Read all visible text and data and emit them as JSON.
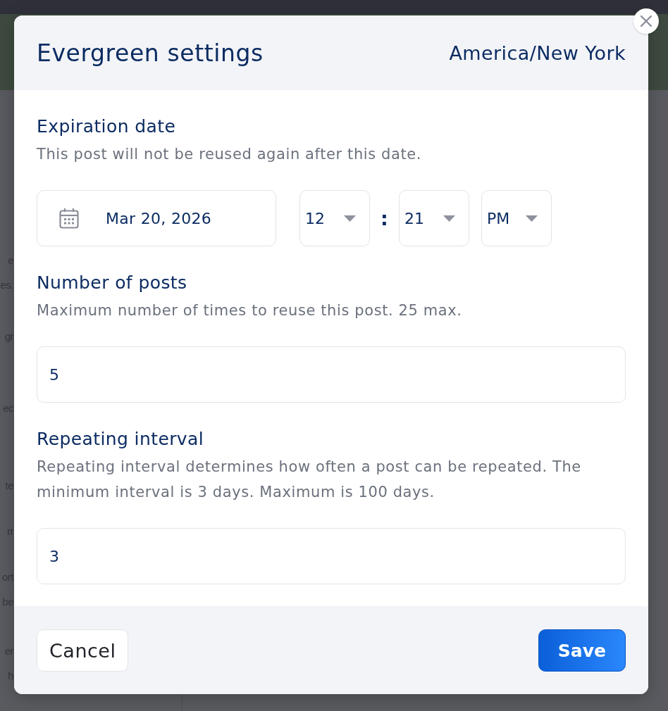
{
  "backdrop": {
    "text_fragments": [
      {
        "lines": [
          "e",
          "es."
        ]
      },
      {
        "lines": [
          "gr"
        ]
      },
      {
        "lines": [
          "ec"
        ]
      },
      {
        "lines": [
          "te"
        ]
      },
      {
        "lines": [
          "rr"
        ]
      },
      {
        "lines": [
          "ort",
          "be"
        ]
      },
      {
        "lines": [
          "er",
          "h"
        ]
      }
    ]
  },
  "dialog": {
    "title": "Evergreen settings",
    "timezone": "America/New York",
    "sections": [
      {
        "kind": "datetime",
        "heading": "Expiration date",
        "description": "This post will not be reused again after this date.",
        "date": "Mar 20, 2026",
        "hour": "12",
        "separator": ":",
        "minute": "21",
        "meridiem": "PM"
      },
      {
        "kind": "number",
        "heading": "Number of posts",
        "description": "Maximum number of times to reuse this post. 25 max.",
        "value": "5"
      },
      {
        "kind": "number",
        "heading": "Repeating interval",
        "description": "Repeating interval determines how often a post can be repeated. The minimum interval is 3 days. Maximum is 100 days.",
        "value": "3"
      }
    ],
    "buttons": [
      {
        "kind": "secondary",
        "label": "Cancel"
      },
      {
        "kind": "primary",
        "label": "Save"
      }
    ]
  }
}
